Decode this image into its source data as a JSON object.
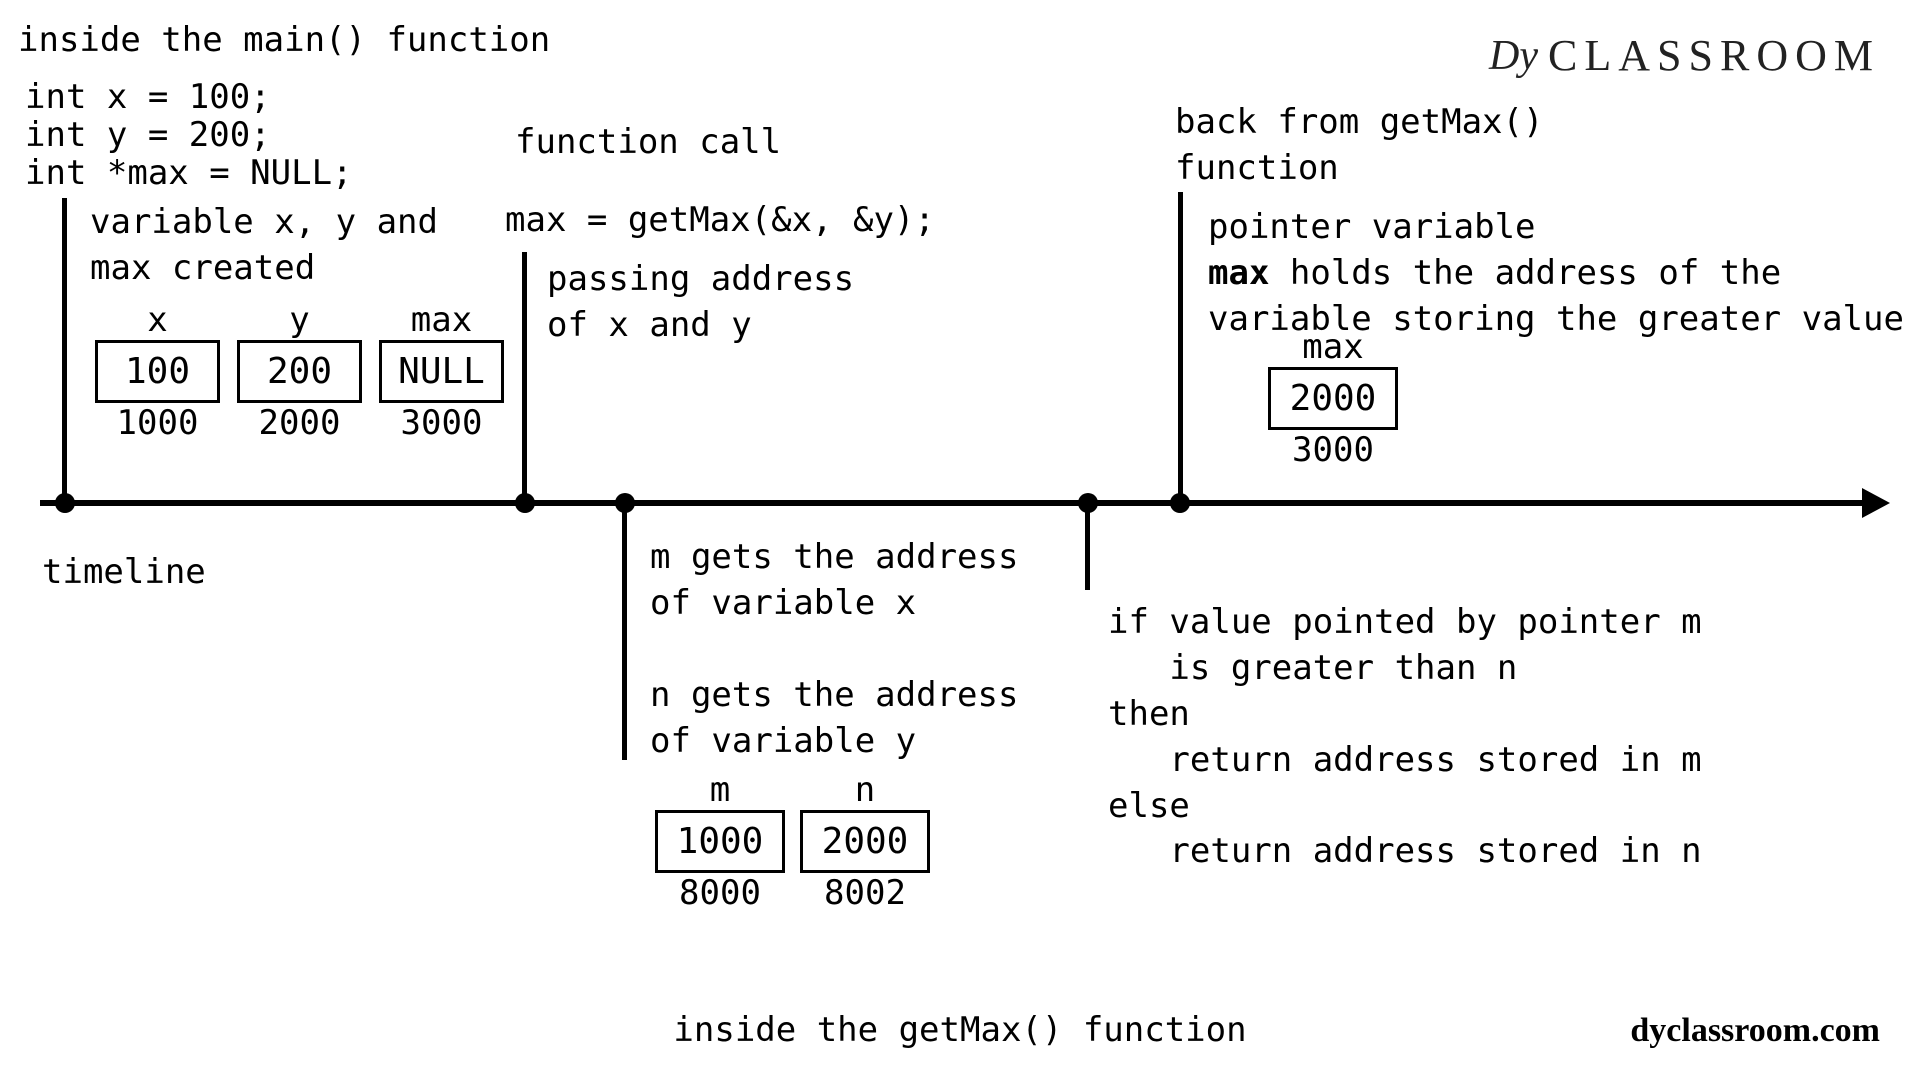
{
  "brand": {
    "icon": "Dy",
    "text": "CLASSROOM",
    "url": "dyclassroom.com"
  },
  "titles": {
    "inside_main": "inside the main() function",
    "inside_getmax": "inside the getMax() function",
    "timeline": "timeline"
  },
  "declarations": {
    "l1": "int x = 100;",
    "l2": "int y = 200;",
    "l3": "int *max = NULL;"
  },
  "stage1": {
    "note": "variable x, y and\nmax created",
    "vars": [
      {
        "name": "x",
        "value": "100",
        "addr": "1000"
      },
      {
        "name": "y",
        "value": "200",
        "addr": "2000"
      },
      {
        "name": "max",
        "value": "NULL",
        "addr": "3000"
      }
    ]
  },
  "stage2": {
    "title": "function call",
    "call": "max = getMax(&x, &y);",
    "note": "passing address\nof x and y"
  },
  "stage3": {
    "note": "m gets the address\nof variable x\n\nn gets the address\nof variable y",
    "vars": [
      {
        "name": "m",
        "value": "1000",
        "addr": "8000"
      },
      {
        "name": "n",
        "value": "2000",
        "addr": "8002"
      }
    ]
  },
  "stage4": {
    "note": "if value pointed by pointer m\n   is greater than n\nthen\n   return address stored in m\nelse\n   return address stored in n"
  },
  "stage5": {
    "title": "back from getMax()\nfunction",
    "note_pre": "pointer variable\n",
    "note_bold": "max",
    "note_post": " holds the address of the\nvariable storing the greater value",
    "var": {
      "name": "max",
      "value": "2000",
      "addr": "3000"
    }
  }
}
